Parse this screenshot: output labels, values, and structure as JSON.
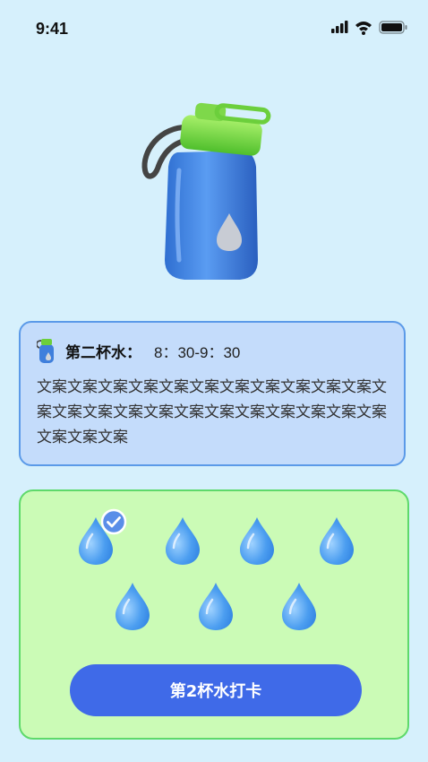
{
  "status_bar": {
    "time": "9:41"
  },
  "card": {
    "title": "第二杯水：",
    "time_range": "8：30-9：30",
    "body": "文案文案文案文案文案文案文案文案文案文案文案文案文案文案文案文案文案文案文案文案文案文案文案文案文案文案"
  },
  "drops": {
    "total": 7,
    "checked": [
      true,
      false,
      false,
      false,
      false,
      false,
      false
    ]
  },
  "button": {
    "label": "第2杯水打卡"
  },
  "colors": {
    "background": "#d6f0fc",
    "info_card_bg": "#c4dcfb",
    "info_card_border": "#5b9ae8",
    "drops_card_bg": "#cbfbb6",
    "drops_card_border": "#5ed96b",
    "button": "#3f6ae8",
    "drop": "#4c9ef0"
  }
}
